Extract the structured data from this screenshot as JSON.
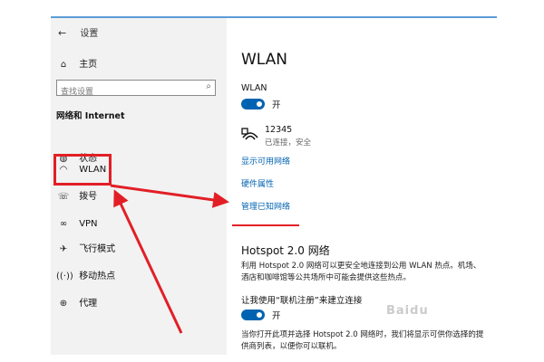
{
  "window": {
    "back_label": "设置"
  },
  "sidebar": {
    "home_label": "主页",
    "search_placeholder": "查找设置",
    "section_title": "网络和 Internet",
    "items": [
      {
        "label": "状态",
        "icon": "status-icon"
      },
      {
        "label": "WLAN",
        "icon": "wifi-icon",
        "active": true
      },
      {
        "label": "拨号",
        "icon": "dialup-icon"
      },
      {
        "label": "VPN",
        "icon": "vpn-icon"
      },
      {
        "label": "飞行模式",
        "icon": "airplane-icon"
      },
      {
        "label": "移动热点",
        "icon": "hotspot-icon"
      },
      {
        "label": "代理",
        "icon": "proxy-icon"
      }
    ]
  },
  "main": {
    "title": "WLAN",
    "wlan_label": "WLAN",
    "wlan_toggle_state": "开",
    "network": {
      "name": "12345",
      "status": "已连接，安全"
    },
    "links": {
      "show_available": "显示可用网络",
      "hardware_props": "硬件属性",
      "manage_known": "管理已知网络"
    },
    "hotspot_title": "Hotspot 2.0 网络",
    "hotspot_desc": "利用 Hotspot 2.0 网络可以更安全地连接到公用 WLAN 热点。机场、酒店和咖啡馆等公共场所中可能会提供这些热点。",
    "signup_label": "让我使用“联机注册”来建立连接",
    "signup_toggle_state": "开",
    "signup_desc": "当你打开此项并选择 Hotspot 2.0 网络时，我们将显示可供你选择的提供商列表，以便你可以联机。"
  },
  "colors": {
    "accent": "#0063b1",
    "annotation_red": "#e21f26",
    "sidebar_bg": "#f2f2f2"
  }
}
